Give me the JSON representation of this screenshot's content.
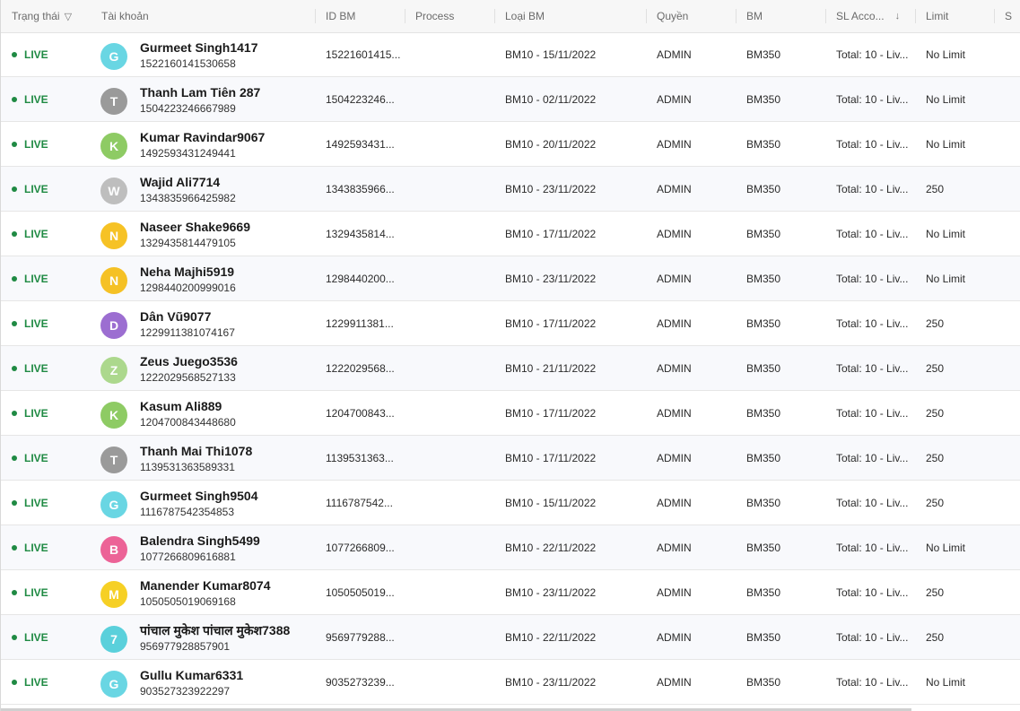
{
  "columns": [
    {
      "key": "status",
      "label": "Trạng thái",
      "icon": "filter-icon"
    },
    {
      "key": "account",
      "label": "Tài khoản"
    },
    {
      "key": "id_bm",
      "label": "ID BM"
    },
    {
      "key": "process",
      "label": "Process"
    },
    {
      "key": "loai_bm",
      "label": "Loại BM"
    },
    {
      "key": "quyen",
      "label": "Quyền"
    },
    {
      "key": "bm",
      "label": "BM"
    },
    {
      "key": "sl_acc",
      "label": "SL Acco...",
      "icon": "sort-down-icon"
    },
    {
      "key": "limit",
      "label": "Limit"
    },
    {
      "key": "next",
      "label": "S"
    }
  ],
  "icons": {
    "filter": "▽",
    "sort": "↓"
  },
  "rows": [
    {
      "status": "LIVE",
      "initial": "G",
      "color": "#4fd0df",
      "name": "Gurmeet Singh1417",
      "uid": "1522160141530658",
      "id_bm": "15221601415...",
      "loai_bm": "BM10 - 15/11/2022",
      "quyen": "ADMIN",
      "bm": "BM350",
      "sl": "Total: 10 - Liv...",
      "limit": "No Limit"
    },
    {
      "status": "LIVE",
      "initial": "T",
      "color": "#8a8a8a",
      "name": "Thanh Lam Tiên 287",
      "uid": "1504223246667989",
      "id_bm": "1504223246...",
      "loai_bm": "BM10 - 02/11/2022",
      "quyen": "ADMIN",
      "bm": "BM350",
      "sl": "Total: 10 - Liv...",
      "limit": "No Limit"
    },
    {
      "status": "LIVE",
      "initial": "K",
      "color": "#7bc24a",
      "name": "Kumar Ravindar9067",
      "uid": "1492593431249441",
      "id_bm": "1492593431...",
      "loai_bm": "BM10 - 20/11/2022",
      "quyen": "ADMIN",
      "bm": "BM350",
      "sl": "Total: 10 - Liv...",
      "limit": "No Limit"
    },
    {
      "status": "LIVE",
      "initial": "W",
      "color": "#b4b4b4",
      "name": "Wajid Ali7714",
      "uid": "1343835966425982",
      "id_bm": "1343835966...",
      "loai_bm": "BM10 - 23/11/2022",
      "quyen": "ADMIN",
      "bm": "BM350",
      "sl": "Total: 10 - Liv...",
      "limit": "250"
    },
    {
      "status": "LIVE",
      "initial": "N",
      "color": "#f5b800",
      "name": "Naseer Shake9669",
      "uid": "1329435814479105",
      "id_bm": "1329435814...",
      "loai_bm": "BM10 - 17/11/2022",
      "quyen": "ADMIN",
      "bm": "BM350",
      "sl": "Total: 10 - Liv...",
      "limit": "No Limit"
    },
    {
      "status": "LIVE",
      "initial": "N",
      "color": "#f5b800",
      "name": "Neha Majhi5919",
      "uid": "1298440200999016",
      "id_bm": "1298440200...",
      "loai_bm": "BM10 - 23/11/2022",
      "quyen": "ADMIN",
      "bm": "BM350",
      "sl": "Total: 10 - Liv...",
      "limit": "No Limit"
    },
    {
      "status": "LIVE",
      "initial": "D",
      "color": "#8b55c9",
      "name": "Dân Vũ9077",
      "uid": "1229911381074167",
      "id_bm": "1229911381...",
      "loai_bm": "BM10 - 17/11/2022",
      "quyen": "ADMIN",
      "bm": "BM350",
      "sl": "Total: 10 - Liv...",
      "limit": "250"
    },
    {
      "status": "LIVE",
      "initial": "Z",
      "color": "#9fd37a",
      "name": "Zeus Juego3536",
      "uid": "1222029568527133",
      "id_bm": "1222029568...",
      "loai_bm": "BM10 - 21/11/2022",
      "quyen": "ADMIN",
      "bm": "BM350",
      "sl": "Total: 10 - Liv...",
      "limit": "250"
    },
    {
      "status": "LIVE",
      "initial": "K",
      "color": "#7bc24a",
      "name": "Kasum Ali889",
      "uid": "1204700843448680",
      "id_bm": "1204700843...",
      "loai_bm": "BM10 - 17/11/2022",
      "quyen": "ADMIN",
      "bm": "BM350",
      "sl": "Total: 10 - Liv...",
      "limit": "250"
    },
    {
      "status": "LIVE",
      "initial": "T",
      "color": "#8a8a8a",
      "name": "Thanh Mai Thi1078",
      "uid": "1139531363589331",
      "id_bm": "1139531363...",
      "loai_bm": "BM10 - 17/11/2022",
      "quyen": "ADMIN",
      "bm": "BM350",
      "sl": "Total: 10 - Liv...",
      "limit": "250"
    },
    {
      "status": "LIVE",
      "initial": "G",
      "color": "#4fd0df",
      "name": "Gurmeet Singh9504",
      "uid": "1116787542354853",
      "id_bm": "1116787542...",
      "loai_bm": "BM10 - 15/11/2022",
      "quyen": "ADMIN",
      "bm": "BM350",
      "sl": "Total: 10 - Liv...",
      "limit": "250"
    },
    {
      "status": "LIVE",
      "initial": "B",
      "color": "#ea4a86",
      "name": "Balendra Singh5499",
      "uid": "1077266809616881",
      "id_bm": "1077266809...",
      "loai_bm": "BM10 - 22/11/2022",
      "quyen": "ADMIN",
      "bm": "BM350",
      "sl": "Total: 10 - Liv...",
      "limit": "No Limit"
    },
    {
      "status": "LIVE",
      "initial": "M",
      "color": "#f5c800",
      "name": "Manender Kumar8074",
      "uid": "1050505019069168",
      "id_bm": "1050505019...",
      "loai_bm": "BM10 - 23/11/2022",
      "quyen": "ADMIN",
      "bm": "BM350",
      "sl": "Total: 10 - Liv...",
      "limit": "250"
    },
    {
      "status": "LIVE",
      "initial": "7",
      "color": "#3fc9d6",
      "name": "पांचाल मुकेश पांचाल मुकेश7388",
      "uid": "956977928857901",
      "id_bm": "9569779288...",
      "loai_bm": "BM10 - 22/11/2022",
      "quyen": "ADMIN",
      "bm": "BM350",
      "sl": "Total: 10 - Liv...",
      "limit": "250"
    },
    {
      "status": "LIVE",
      "initial": "G",
      "color": "#4fd0df",
      "name": "Gullu Kumar6331",
      "uid": "903527323922297",
      "id_bm": "9035273239...",
      "loai_bm": "BM10 - 23/11/2022",
      "quyen": "ADMIN",
      "bm": "BM350",
      "sl": "Total: 10 - Liv...",
      "limit": "No Limit"
    }
  ]
}
